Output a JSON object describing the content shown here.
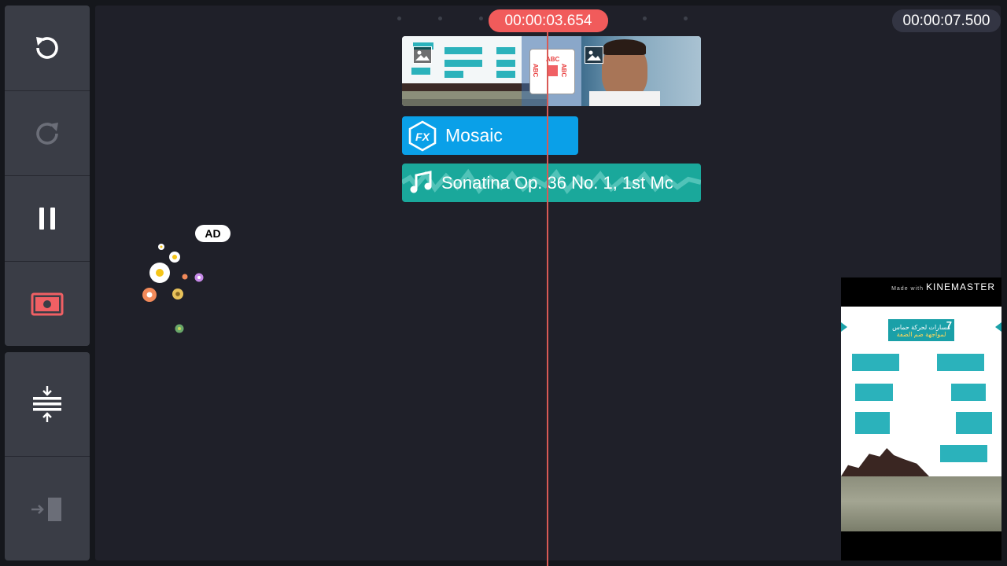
{
  "toolbar": {
    "undo": {
      "icon": "undo-icon"
    },
    "redo": {
      "icon": "redo-icon"
    },
    "pause": {
      "icon": "pause-icon"
    },
    "capture": {
      "icon": "screen-capture-icon",
      "color": "#f06064"
    },
    "adjust_height": {
      "icon": "timeline-height-icon"
    },
    "jump": {
      "icon": "jump-to-end-icon"
    }
  },
  "timeline": {
    "current_time": "00:00:03.654",
    "total_time": "00:00:07.500",
    "current_time_color": "#f15b5b",
    "fx_clip": {
      "label": "Mosaic",
      "badge": "FX",
      "color": "#0aa0e8"
    },
    "audio_clip": {
      "label": "Sonatina Op. 36 No. 1, 1st Mc",
      "color": "#1aa89b"
    },
    "transition_badge": "ABC"
  },
  "ad": {
    "label": "AD"
  },
  "preview": {
    "watermark_prefix": "Made with",
    "watermark_brand": "KINEMASTER",
    "banner_number": "7",
    "banner_line1": "مسارات لحركة حماس",
    "banner_line2": "لمواجهة ضم الضفة"
  }
}
